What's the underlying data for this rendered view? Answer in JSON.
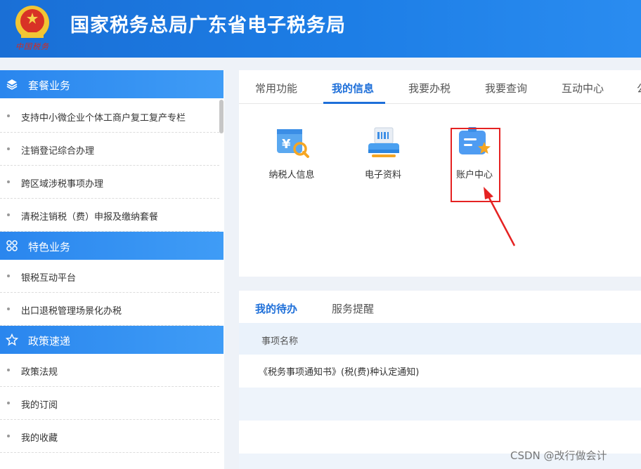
{
  "header": {
    "title": "国家税务总局广东省电子税务局",
    "emblem_caption": "中国税务"
  },
  "sidebar": {
    "sections": [
      {
        "label": "套餐业务",
        "icon": "layers-icon",
        "items": [
          "支持中小微企业个体工商户复工复产专栏",
          "注销登记综合办理",
          "跨区域涉税事项办理",
          "清税注销税（费）申报及缴纳套餐"
        ]
      },
      {
        "label": "特色业务",
        "icon": "grid-icon",
        "items": [
          "银税互动平台",
          "出口退税管理场景化办税"
        ]
      },
      {
        "label": "政策速递",
        "icon": "star-outline-icon",
        "items": [
          "政策法规",
          "我的订阅",
          "我的收藏"
        ]
      }
    ]
  },
  "main_tabs": {
    "items": [
      "常用功能",
      "我的信息",
      "我要办税",
      "我要查询",
      "互动中心",
      "公"
    ],
    "active": "我的信息"
  },
  "apps": [
    {
      "label": "纳税人信息",
      "icon": "taxpayer-info-icon"
    },
    {
      "label": "电子资料",
      "icon": "electronic-docs-icon"
    },
    {
      "label": "账户中心",
      "icon": "account-center-icon"
    }
  ],
  "todo": {
    "tabs": [
      "我的待办",
      "服务提醒"
    ],
    "active": "我的待办",
    "column_header": "事项名称",
    "rows": [
      "《税务事项通知书》(税(费)种认定通知)",
      "",
      "",
      ""
    ]
  },
  "watermark": "CSDN @改行做会计",
  "colors": {
    "brand_blue": "#1e6fd9",
    "highlight_red": "#e52222"
  }
}
